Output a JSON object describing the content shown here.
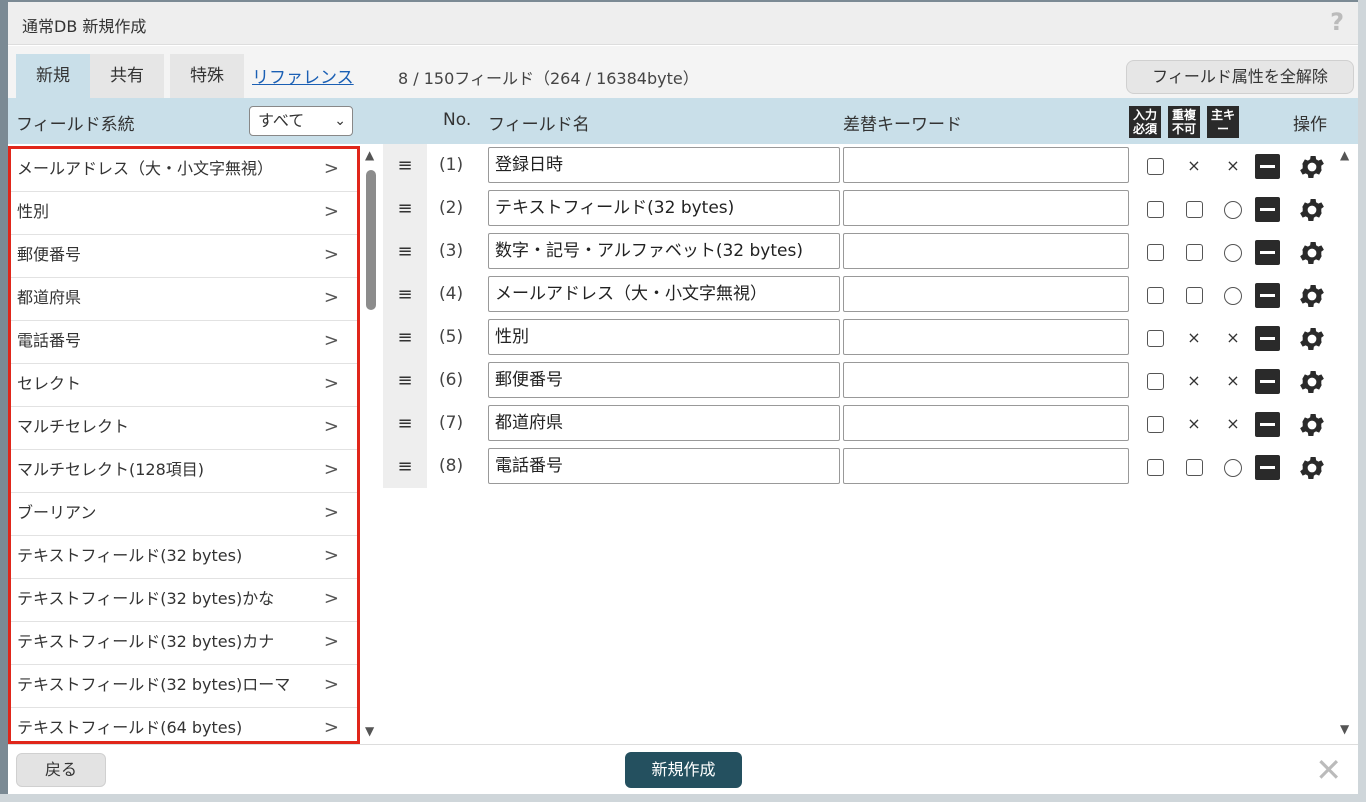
{
  "dialog": {
    "title": "通常DB 新規作成",
    "help_icon": "?"
  },
  "tabs": [
    {
      "label": "新規",
      "active": true
    },
    {
      "label": "共有",
      "active": false
    },
    {
      "label": "特殊",
      "active": false
    }
  ],
  "reference_link": "リファレンス",
  "field_count": "8 / 150フィールド（264 / 16384byte）",
  "clear_attributes_button": "フィールド属性を全解除",
  "header": {
    "field_type": "フィールド系統",
    "filter_value": "すべて",
    "no": "No.",
    "field_name": "フィールド名",
    "keyword": "差替キーワード",
    "icon_required": "入力必須",
    "icon_unique": "重複不可",
    "icon_primary": "主キー",
    "operation": "操作"
  },
  "field_types": [
    "メールアドレス（大・小文字無視）",
    "性別",
    "郵便番号",
    "都道府県",
    "電話番号",
    "セレクト",
    "マルチセレクト",
    "マルチセレクト(128項目)",
    "ブーリアン",
    "テキストフィールド(32 bytes)",
    "テキストフィールド(32 bytes)かな",
    "テキストフィールド(32 bytes)カナ",
    "テキストフィールド(32 bytes)ローマ",
    "テキストフィールド(64 bytes)"
  ],
  "list_arrow": ">",
  "handle_glyph": "≡",
  "fields": [
    {
      "no": "(1)",
      "name": "登録日時",
      "keyword": "",
      "required": false,
      "unique": "×",
      "primary": "×"
    },
    {
      "no": "(2)",
      "name": "テキストフィールド(32 bytes)",
      "keyword": "",
      "required": false,
      "unique": "checkbox",
      "primary": "○"
    },
    {
      "no": "(3)",
      "name": "数字・記号・アルファベット(32 bytes)",
      "keyword": "",
      "required": false,
      "unique": "checkbox",
      "primary": "○"
    },
    {
      "no": "(4)",
      "name": "メールアドレス（大・小文字無視）",
      "keyword": "",
      "required": false,
      "unique": "checkbox",
      "primary": "○"
    },
    {
      "no": "(5)",
      "name": "性別",
      "keyword": "",
      "required": false,
      "unique": "×",
      "primary": "×"
    },
    {
      "no": "(6)",
      "name": "郵便番号",
      "keyword": "",
      "required": false,
      "unique": "×",
      "primary": "×"
    },
    {
      "no": "(7)",
      "name": "都道府県",
      "keyword": "",
      "required": false,
      "unique": "×",
      "primary": "×"
    },
    {
      "no": "(8)",
      "name": "電話番号",
      "keyword": "",
      "required": false,
      "unique": "checkbox",
      "primary": "○"
    }
  ],
  "footer": {
    "back_button": "戻る",
    "create_button": "新規作成",
    "close_icon": "✕"
  },
  "colors": {
    "header_bg": "#c9dfe9",
    "primary_button": "#24505f",
    "highlight_border": "#e0261a",
    "link": "#1a5fb4"
  }
}
